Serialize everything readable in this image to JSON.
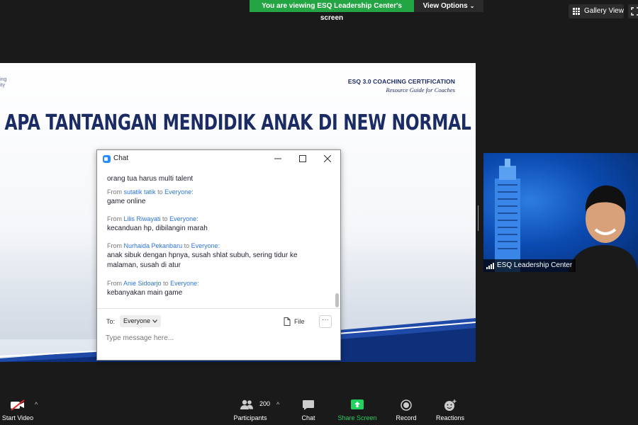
{
  "top_bar": {
    "viewing_banner": "You are viewing ESQ Leadership Center's screen",
    "view_options": "View Options",
    "gallery_view": "Gallery View"
  },
  "slide": {
    "logo_fragment_1": "ing",
    "logo_fragment_2": "ity",
    "cert_line1": "ESQ 3.0 COACHING CERTIFICATION",
    "cert_line2": "Resource Guide for Coaches",
    "title": "APA TANTANGAN MENDIDIK ANAK DI NEW NORMAL"
  },
  "video": {
    "participant_name": "ESQ Leadership Center"
  },
  "chat": {
    "title": "Chat",
    "from_word": "From",
    "to_word": "to",
    "messages": [
      {
        "text": "orang tua harus multi talent"
      },
      {
        "sender": "sutatik tatik",
        "recipient": "Everyone:",
        "text": "game online"
      },
      {
        "sender": "Lilis Riwayati",
        "recipient": "Everyone:",
        "text": "kecanduan hp, dibilangin marah"
      },
      {
        "sender": "Nurhaida Pekanbaru",
        "recipient": "Everyone:",
        "text": "anak sibuk dengan hpnya, susah shlat subuh, sering tidur ke malaman, susah di atur"
      },
      {
        "sender": "Anie Sidoarjo",
        "recipient": "Everyone:",
        "text": "kebanyakan main game"
      }
    ],
    "to_label": "To:",
    "to_value": "Everyone",
    "file_label": "File",
    "more_label": "···",
    "input_placeholder": "Type message here..."
  },
  "toolbar": {
    "start_video": "Start Video",
    "participants": "Participants",
    "participants_count": "200",
    "chat": "Chat",
    "share_screen": "Share Screen",
    "record": "Record",
    "reactions": "Reactions"
  },
  "colors": {
    "banner_green": "#23a543",
    "share_green": "#23d160",
    "slide_navy": "#1b2b63",
    "link_blue": "#2d75d6",
    "zoom_blue": "#2d8cff"
  }
}
